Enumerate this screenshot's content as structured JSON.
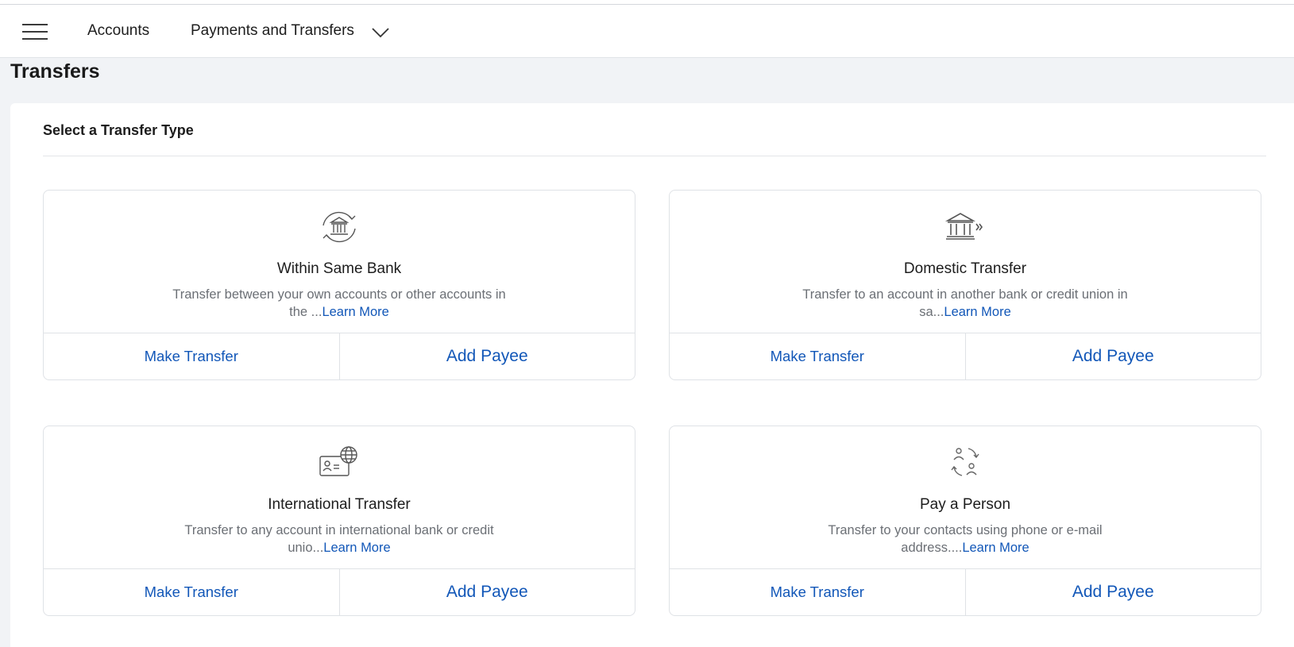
{
  "nav": {
    "items": [
      {
        "label": "Accounts"
      },
      {
        "label": "Payments and Transfers"
      }
    ]
  },
  "page": {
    "title": "Transfers",
    "section_title": "Select a Transfer Type"
  },
  "cards": [
    {
      "icon": "bank-transfer-icon",
      "title": "Within Same Bank",
      "desc_line1": "Transfer between your own accounts or other accounts in",
      "desc_line2": "the ...",
      "learn_more": "Learn More",
      "make_transfer": "Make Transfer",
      "add_payee": "Add Payee"
    },
    {
      "icon": "bank-outgoing-icon",
      "title": "Domestic Transfer",
      "desc_line1": "Transfer to an account in another bank or credit union in",
      "desc_line2": "sa...",
      "learn_more": "Learn More",
      "make_transfer": "Make Transfer",
      "add_payee": "Add Payee"
    },
    {
      "icon": "international-card-globe-icon",
      "title": "International Transfer",
      "desc_line1": "Transfer to any account in international bank or credit",
      "desc_line2": "unio...",
      "learn_more": "Learn More",
      "make_transfer": "Make Transfer",
      "add_payee": "Add Payee"
    },
    {
      "icon": "person-to-person-icon",
      "title": "Pay a Person",
      "desc_line1": "Transfer to your contacts using phone or e-mail",
      "desc_line2": "address....",
      "learn_more": "Learn More",
      "make_transfer": "Make Transfer",
      "add_payee": "Add Payee"
    }
  ],
  "colors": {
    "link": "#1257b8",
    "background": "#f1f3f6",
    "card_border": "#dfe2e6"
  }
}
